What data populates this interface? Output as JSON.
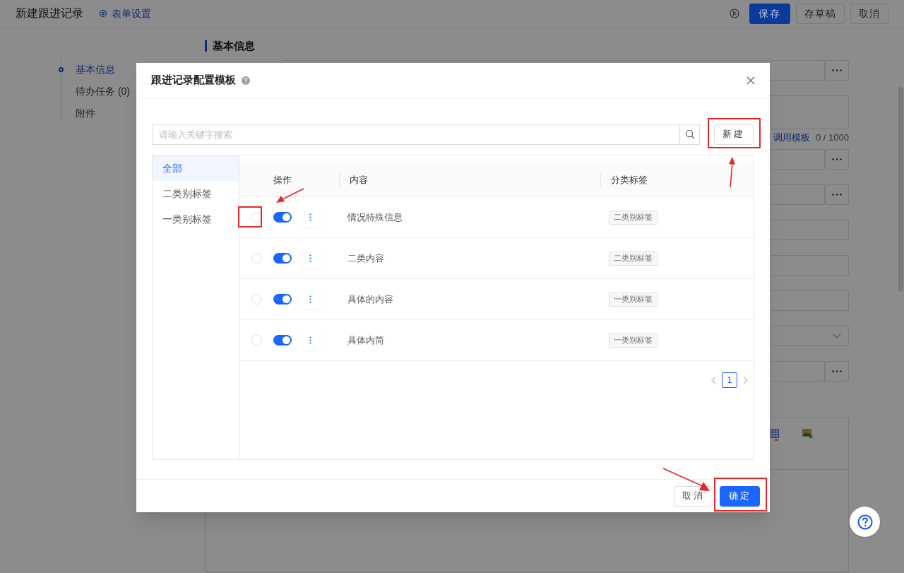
{
  "page": {
    "title": "新建跟进记录",
    "settings_link": "表单设置",
    "buttons": [
      {
        "label": "保存",
        "primary": true
      },
      {
        "label": "存草稿",
        "primary": false
      },
      {
        "label": "取消",
        "primary": false
      }
    ]
  },
  "nav": [
    {
      "label": "基本信息",
      "selected": true
    },
    {
      "label": "待办任务 (0)",
      "selected": false
    },
    {
      "label": "附件",
      "selected": false
    }
  ],
  "form": {
    "section_title": "基本信息",
    "template_link": "调用模板",
    "char_count": "0 / 1000",
    "fields": [
      {
        "kind": "picker"
      },
      {
        "kind": "textarea"
      },
      {
        "kind": "picker"
      },
      {
        "kind": "picker"
      },
      {
        "kind": "input"
      },
      {
        "kind": "input"
      },
      {
        "kind": "input"
      },
      {
        "kind": "select"
      },
      {
        "kind": "picker"
      },
      {
        "kind": "editor"
      }
    ]
  },
  "modal": {
    "title": "跟进记录配置模板",
    "search": {
      "placeholder": "请输入关键字搜索"
    },
    "new_button": "新建",
    "categories": [
      {
        "label": "全部",
        "selected": true
      },
      {
        "label": "二类别标签",
        "selected": false
      },
      {
        "label": "一类别标签",
        "selected": false
      }
    ],
    "table": {
      "columns": [
        "操作",
        "内容",
        "分类标签"
      ],
      "rows": [
        {
          "selected": false,
          "enabled": true,
          "content": "情况特殊信息",
          "tag": "二类别标签"
        },
        {
          "selected": false,
          "enabled": true,
          "content": "二类内容",
          "tag": "二类别标签"
        },
        {
          "selected": false,
          "enabled": true,
          "content": "具体的内容",
          "tag": "一类别标签"
        },
        {
          "selected": false,
          "enabled": true,
          "content": "具体内简",
          "tag": "一类别标签"
        }
      ]
    },
    "pages": [
      {
        "label": "1",
        "selected": true
      }
    ],
    "buttons": [
      {
        "label": "取消",
        "primary": false
      },
      {
        "label": "确定",
        "primary": true
      }
    ]
  }
}
